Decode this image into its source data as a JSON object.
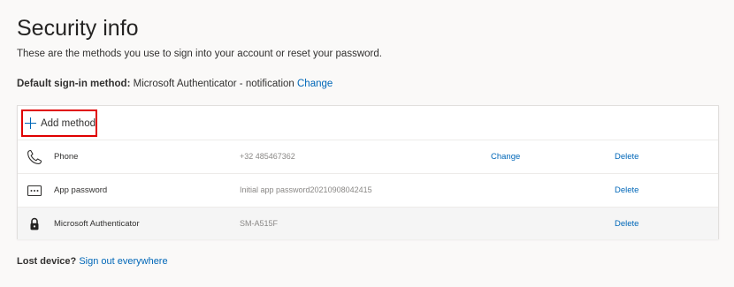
{
  "page": {
    "title": "Security info",
    "subtitle": "These are the methods you use to sign into your account or reset your password."
  },
  "default_method": {
    "label": "Default sign-in method:",
    "value": "Microsoft Authenticator - notification",
    "change_link": "Change"
  },
  "methods_card": {
    "add_method_label": "Add method",
    "rows": [
      {
        "icon": "phone-icon",
        "name": "Phone",
        "detail": "+32 485467362",
        "change_link": "Change",
        "delete_link": "Delete"
      },
      {
        "icon": "app-password-icon",
        "name": "App password",
        "detail": "Initial app password20210908042415",
        "delete_link": "Delete"
      },
      {
        "icon": "authenticator-lock-icon",
        "name": "Microsoft Authenticator",
        "detail": "SM-A515F",
        "delete_link": "Delete"
      }
    ]
  },
  "footer": {
    "lost_device_label": "Lost device?",
    "sign_out_link": "Sign out everywhere"
  },
  "colors": {
    "link": "#0067b8",
    "highlight_border": "#e00000",
    "background": "#faf9f8"
  }
}
